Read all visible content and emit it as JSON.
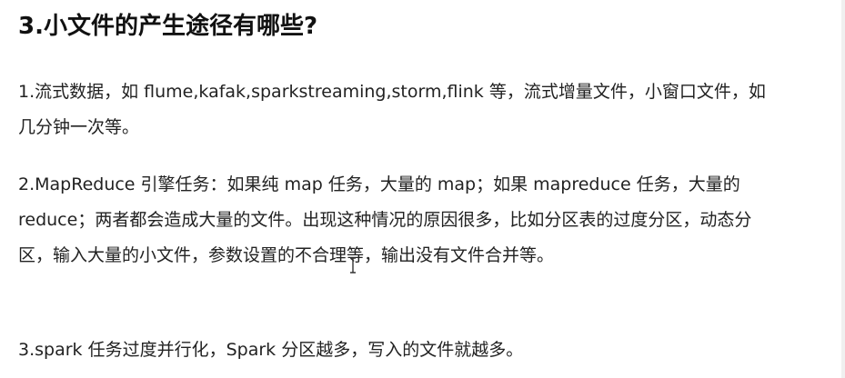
{
  "heading": "3.小文件的产生途径有哪些?",
  "paragraphs": [
    "1.流式数据，如 flume,kafak,sparkstreaming,storm,flink 等，流式增量文件，小窗口文件，如几分钟一次等。",
    "2.MapReduce 引擎任务：如果纯 map 任务，大量的 map；如果 mapreduce 任务，大量的 reduce；两者都会造成大量的文件。出现这种情况的原因很多，比如分区表的过度分区，动态分区，输入大量的小文件，参数设置的不合理等，输出没有文件合并等。",
    "3.spark 任务过度并行化，Spark  分区越多，写入的文件就越多。"
  ],
  "icons": {
    "cursor": "text-cursor-icon"
  }
}
